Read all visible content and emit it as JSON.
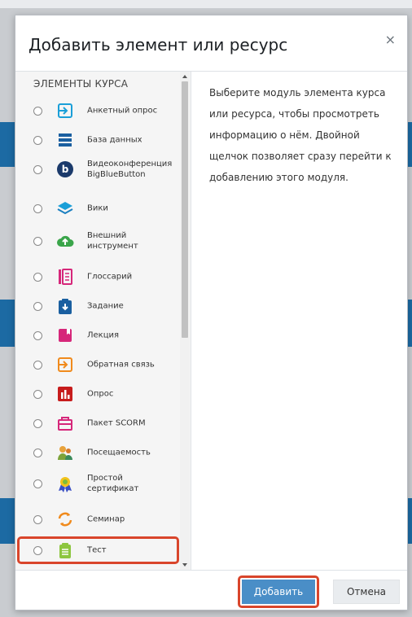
{
  "dialog": {
    "title": "Добавить элемент или ресурс",
    "close_glyph": "×"
  },
  "modules": {
    "section_heading": "ЭЛЕМЕНТЫ КУРСА",
    "items": [
      {
        "label": "Анкетный опрос",
        "icon": "questionnaire-icon"
      },
      {
        "label": "База данных",
        "icon": "database-icon"
      },
      {
        "label": "Видеоконференция BigBlueButton",
        "icon": "bigbluebutton-icon"
      },
      {
        "label": "Вики",
        "icon": "wiki-icon"
      },
      {
        "label": "Внешний инструмент",
        "icon": "external-tool-icon"
      },
      {
        "label": "Глоссарий",
        "icon": "glossary-icon"
      },
      {
        "label": "Задание",
        "icon": "assignment-icon"
      },
      {
        "label": "Лекция",
        "icon": "lesson-icon"
      },
      {
        "label": "Обратная связь",
        "icon": "feedback-icon"
      },
      {
        "label": "Опрос",
        "icon": "choice-icon"
      },
      {
        "label": "Пакет SCORM",
        "icon": "scorm-icon"
      },
      {
        "label": "Посещаемость",
        "icon": "attendance-icon"
      },
      {
        "label": "Простой сертификат",
        "icon": "certificate-icon"
      },
      {
        "label": "Семинар",
        "icon": "workshop-icon"
      },
      {
        "label": "Тест",
        "icon": "quiz-icon"
      }
    ]
  },
  "info": {
    "text": "Выберите модуль элемента курса или ресурса, чтобы просмотреть информацию о нём. Двойной щелчок позволяет сразу перейти к добавлению этого модуля."
  },
  "footer": {
    "add_label": "Добавить",
    "cancel_label": "Отмена"
  },
  "colors": {
    "accent": "#4a8ec7",
    "highlight": "#d9452b"
  }
}
